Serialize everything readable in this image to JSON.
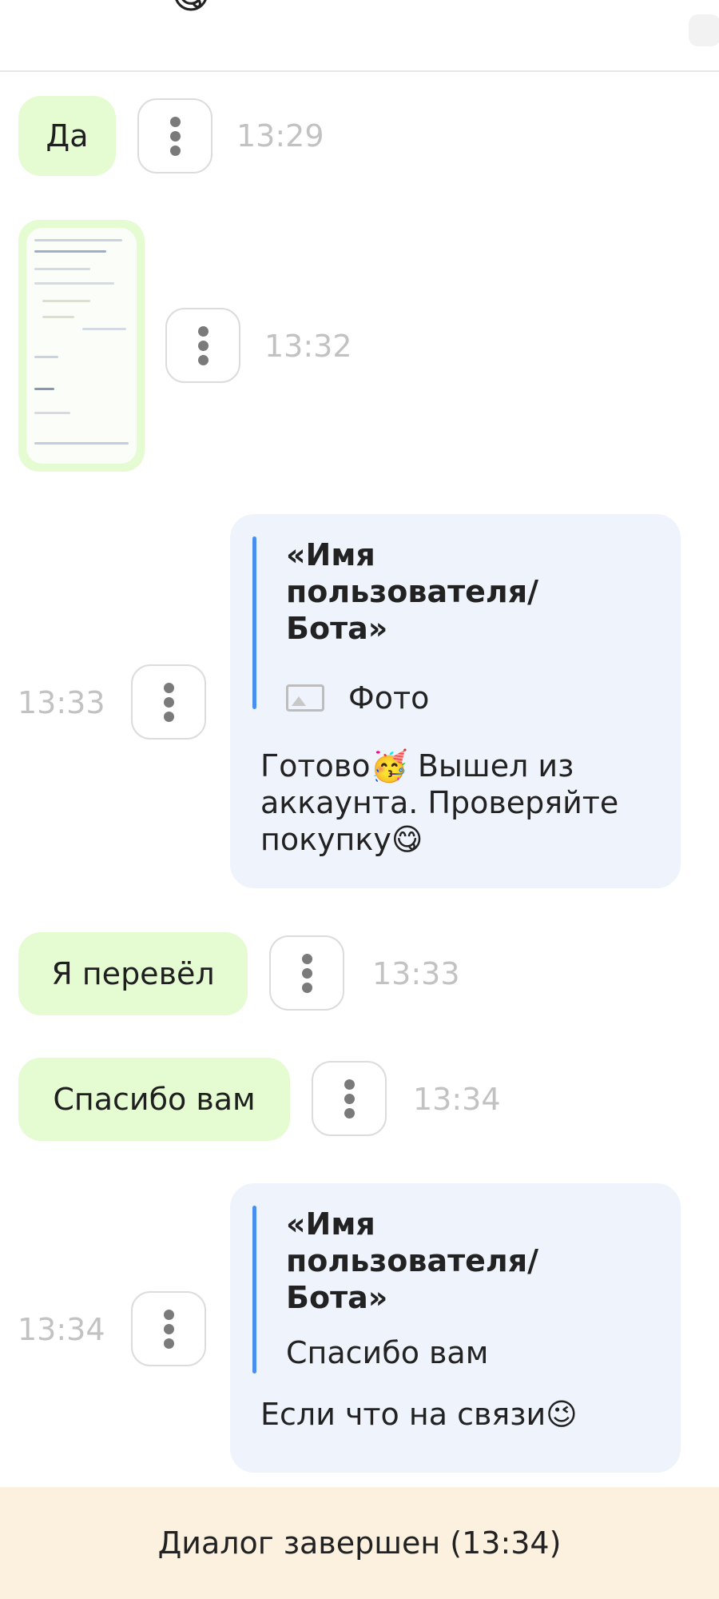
{
  "header": {
    "title": "",
    "emoji": "😋"
  },
  "messages": [
    {
      "id": "m1",
      "text": "Да",
      "time": "13:29"
    },
    {
      "id": "m2",
      "type": "photo",
      "time": "13:32"
    },
    {
      "id": "m3",
      "quote_name": "«Имя пользователя/ Бота»",
      "quote_text": "Фото",
      "text": "Готово🥳 Вышел из аккаунта. Проверяйте покупку😋",
      "time": "13:33"
    },
    {
      "id": "m4",
      "text": "Я перевёл",
      "time": "13:33"
    },
    {
      "id": "m5",
      "text": "Спасибо вам",
      "time": "13:34"
    },
    {
      "id": "m6",
      "quote_name": "«Имя пользователя/ Бота»",
      "quote_text": "Спасибо вам",
      "text": "Если что на связи😉",
      "time": "13:34"
    }
  ],
  "footer": {
    "status": "Диалог завершен (13:34)"
  },
  "icons": {
    "menu": "more-vertical-icon",
    "photo": "image-icon"
  },
  "colors": {
    "incoming_bubble": "#e5fbd2",
    "outgoing_bubble": "#eef3fc",
    "quote_bar": "#4a8ef0",
    "footer_bg": "#fcf1df"
  }
}
